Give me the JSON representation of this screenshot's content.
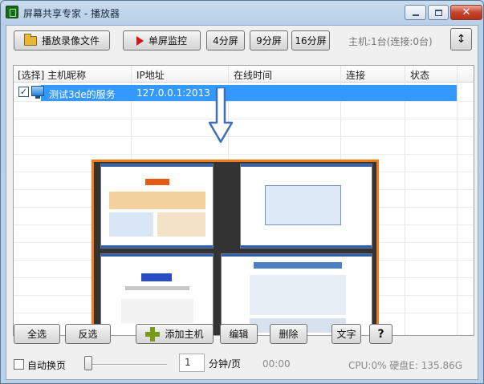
{
  "window": {
    "title": "屏幕共享专家 - 播放器"
  },
  "toolbar": {
    "play_recording_label": "播放录像文件",
    "single_monitor_label": "单屏监控",
    "split4_label": "4分屏",
    "split9_label": "9分屏",
    "split16_label": "16分屏",
    "host_stat": "主机:1台(连接:0台)",
    "toggle_glyph": "↕"
  },
  "list": {
    "columns": [
      "[选择] 主机昵称",
      "IP地址",
      "在线时间",
      "连接",
      "状态"
    ],
    "rows": [
      {
        "checked": true,
        "name": "测试3de的服务",
        "ip": "127.0.0.1:2013",
        "online_time": "",
        "connection": "",
        "status": ""
      }
    ]
  },
  "bottom": {
    "select_all_label": "全选",
    "invert_label": "反选",
    "add_host_label": "添加主机",
    "edit_label": "编辑",
    "delete_label": "删除",
    "text_label": "文字",
    "help_glyph": "?",
    "auto_page_label": "自动换页",
    "minutes_value": "1",
    "minutes_unit": "分钟/页",
    "timer": "00:00",
    "sys_stat": "CPU:0%  硬盘E: 135.86G"
  },
  "colors": {
    "accent_blue": "#3399ff",
    "preview_border": "#f07a1c",
    "arrow": "#3f6fb6"
  }
}
